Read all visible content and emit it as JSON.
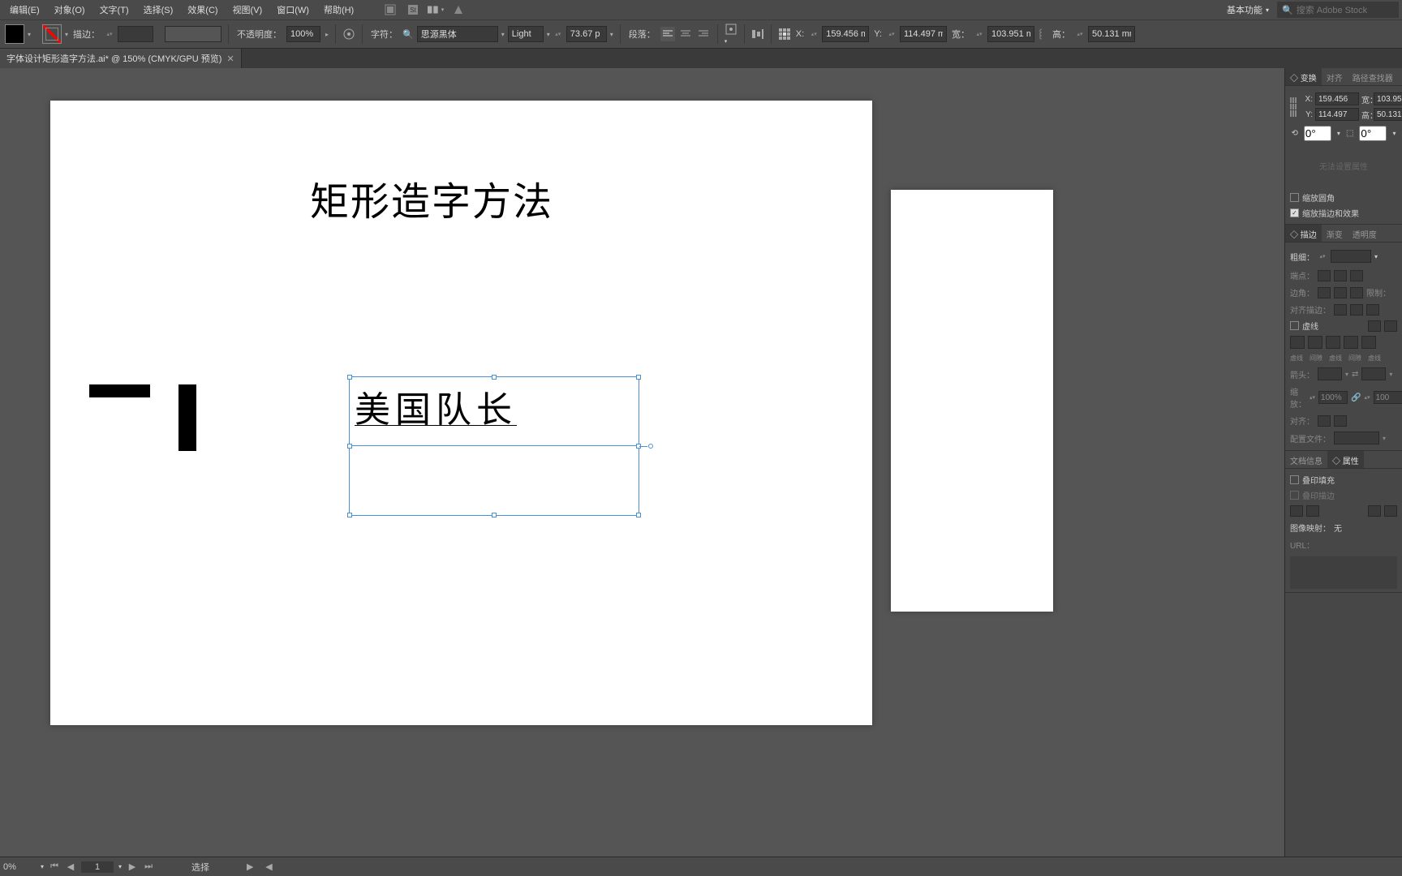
{
  "menu": {
    "edit": "编辑(E)",
    "object": "对象(O)",
    "type": "文字(T)",
    "select": "选择(S)",
    "effect": "效果(C)",
    "view": "视图(V)",
    "window": "窗口(W)",
    "help": "帮助(H)"
  },
  "workspace_label": "基本功能",
  "search_placeholder": "搜索 Adobe Stock",
  "controls": {
    "stroke_label": "描边：",
    "opacity_label": "不透明度：",
    "opacity_value": "100%",
    "char_label": "字符：",
    "font_name": "思源黑体",
    "font_style": "Light",
    "font_size": "73.67 p",
    "para_label": "段落：",
    "x_label": "X:",
    "x_value": "159.456 m",
    "y_label": "Y:",
    "y_value": "114.497 m",
    "w_label": "宽：",
    "w_value": "103.951 m",
    "h_label": "高：",
    "h_value": "50.131 mm"
  },
  "doc_tab": "字体设计矩形造字方法.ai* @ 150% (CMYK/GPU 预览)",
  "canvas": {
    "title": "矩形造字方法",
    "selected_text": "美国队长"
  },
  "panels": {
    "transform_tab": "变换",
    "align_tab": "对齐",
    "pathfinder_tab": "路径查找器",
    "x": "X:",
    "x_val": "159.456",
    "w": "宽：",
    "w_val": "103.95",
    "y": "Y:",
    "y_val": "114.497",
    "h": "高：",
    "h_val": "50.131",
    "angle": "0°",
    "shear": "0°",
    "no_bounds": "无法设置属性",
    "scale_corners": "缩放圆角",
    "scale_strokes": "缩放描边和效果",
    "stroke_tab": "描边",
    "gradient_tab": "渐变",
    "transparency_tab": "透明度",
    "weight_label": "粗细：",
    "cap_label": "端点：",
    "corner_label": "边角：",
    "limit_label": "限制：",
    "align_stroke_label": "对齐描边：",
    "dashed": "虚线",
    "dash_label": "虚线",
    "gap_label": "间隙",
    "dash2": "虚线",
    "gap2": "间隙",
    "dash3": "虚线",
    "arrow_label": "箭头：",
    "scale_label": "缩放：",
    "scale_val": "100%",
    "scale_val2": "100",
    "align_label2": "对齐：",
    "profile_label": "配置文件：",
    "docinfo_tab": "文档信息",
    "attributes_tab": "属性",
    "overprint_fill": "叠印填充",
    "overprint_stroke": "叠印描边",
    "imagemap_label": "图像映射：",
    "imagemap_val": "无",
    "url_label": "URL："
  },
  "status": {
    "zoom": "0%",
    "page": "1",
    "tool": "选择"
  }
}
